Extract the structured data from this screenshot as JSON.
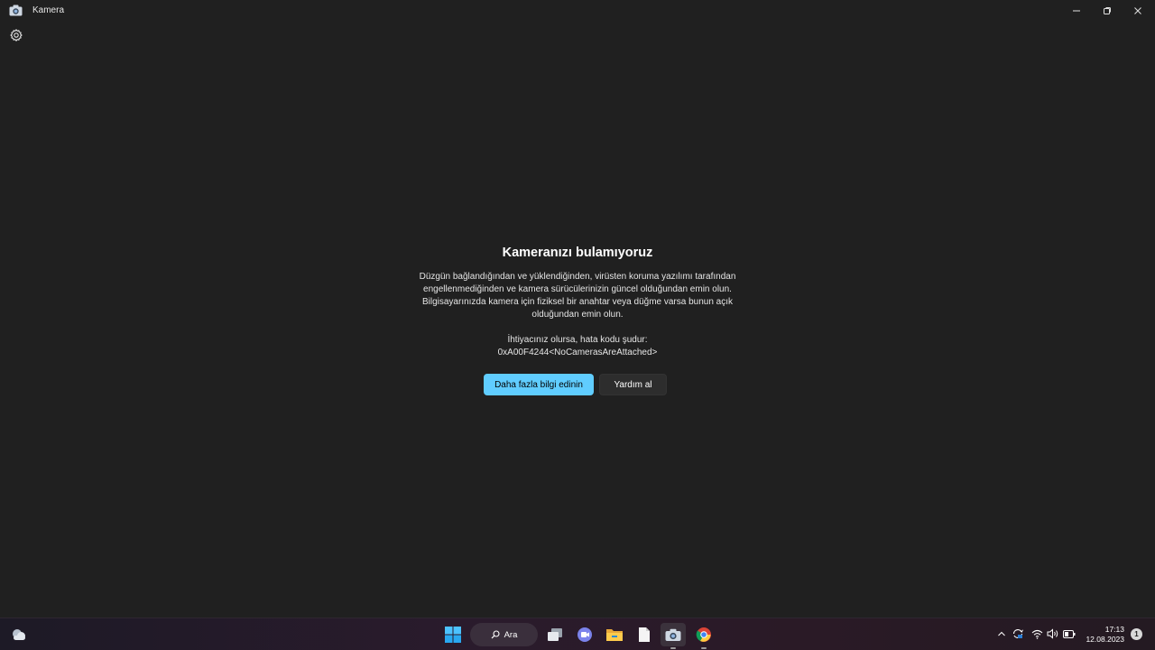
{
  "window": {
    "title": "Kamera",
    "icon": "camera-icon",
    "controls": [
      "minimize-icon",
      "restore-icon",
      "close-icon"
    ]
  },
  "settings": {
    "icon": "gear-icon"
  },
  "error": {
    "heading": "Kameranızı bulamıyoruz",
    "lines": [
      "Düzgün bağlandığından ve yüklendiğinden, virüsten koruma yazılımı tarafından",
      "engellenmediğinden ve kamera sürücülerinizin güncel olduğundan emin olun.",
      "Bilgisayarınızda kamera için fiziksel bir anahtar veya düğme varsa bunun açık",
      "olduğundan emin olun."
    ],
    "code_label": "İhtiyacınız olursa, hata kodu şudur:",
    "code": "0xA00F4244<NoCamerasAreAttached>",
    "primary_button": "Daha fazla bilgi edinin",
    "secondary_button": "Yardım al"
  },
  "taskbar": {
    "weather_icon": "weather-cloud-icon",
    "search_label": "Ara",
    "apps": [
      "start-icon",
      "task-view-icon",
      "teams-icon",
      "file-explorer-icon",
      "notepad-icon",
      "camera-icon",
      "chrome-icon"
    ],
    "tray": [
      "chevron-up-icon",
      "sync-icon",
      "wifi-icon",
      "volume-icon",
      "battery-icon"
    ],
    "time": "17:13",
    "date": "12.08.2023",
    "notification_count": "1"
  },
  "colors": {
    "background": "#202020",
    "accent": "#60cdff"
  }
}
